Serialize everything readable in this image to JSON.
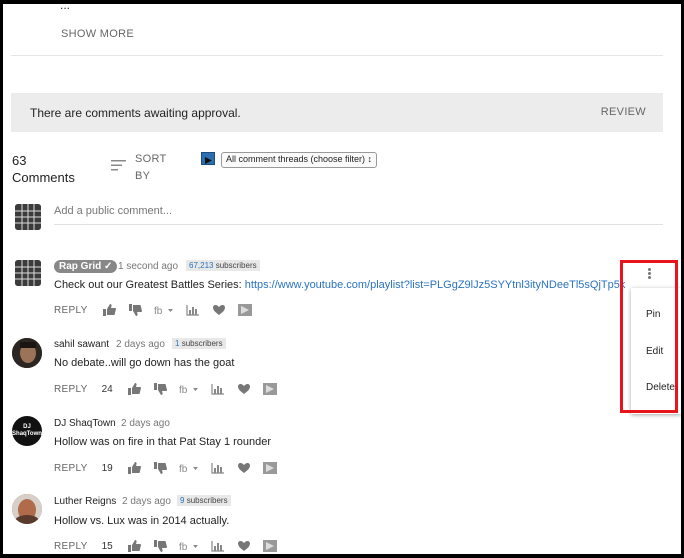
{
  "top": {
    "partial_text": "...",
    "show_more": "SHOW MORE"
  },
  "approval": {
    "message": "There are comments awaiting approval.",
    "review": "REVIEW"
  },
  "comments_header": {
    "count": "63",
    "count_label": "Comments",
    "sort_line1": "SORT",
    "sort_line2": "BY",
    "filter": "All comment threads (choose filter) ↕"
  },
  "add_comment": {
    "placeholder": "Add a public comment..."
  },
  "comments": [
    {
      "author": "Rap Grid",
      "verified": "✓",
      "time": "1 second ago",
      "subs_count": "67,213",
      "subs_label": "subscribers",
      "text": "Check out our Greatest Battles Series: ",
      "link": "https://www.youtube.com/playlist?list=PLGgZ9lJz5SYYtnl3ityNDeeTl5sQjTp5k",
      "reply": "REPLY",
      "likes": ""
    },
    {
      "author": "sahil sawant",
      "time": "2 days ago",
      "subs_count": "1",
      "subs_label": "subscribers",
      "text": "No debate..will go down has the goat",
      "reply": "REPLY",
      "likes": "24"
    },
    {
      "author": "DJ ShaqTown",
      "avatar_text": "DJ ShaqTown",
      "time": "2 days ago",
      "text": "Hollow was on fire in that Pat Stay 1 rounder",
      "reply": "REPLY",
      "likes": "19"
    },
    {
      "author": "Luther Reigns",
      "time": "2 days ago",
      "subs_count": "9",
      "subs_label": "subscribers",
      "text": "Hollow vs. Lux was in 2014 actually.",
      "reply": "REPLY",
      "likes": "15"
    }
  ],
  "context_menu": {
    "items": [
      "Pin",
      "Edit",
      "Delete"
    ]
  },
  "colors": {
    "link": "#2a73c0",
    "highlight": "#e8141c",
    "approval_bg": "#ececec"
  }
}
